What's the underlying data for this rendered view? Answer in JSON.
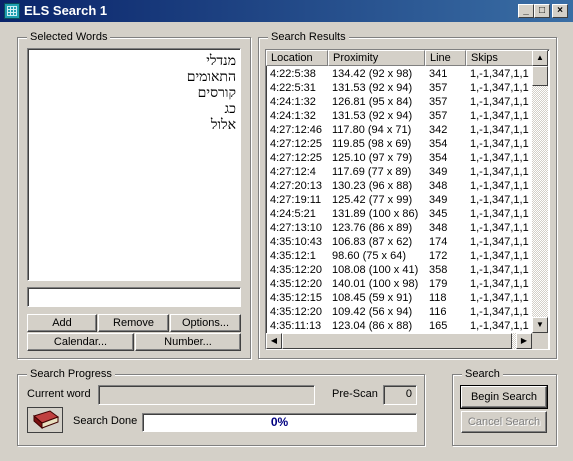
{
  "window": {
    "title": "ELS Search 1",
    "minimize": "_",
    "maximize": "□",
    "close": "×"
  },
  "selected_words": {
    "label": "Selected Words",
    "words": [
      "מנדלי",
      "התאומים",
      "קורסים",
      "כג",
      "אלול"
    ],
    "input_value": "",
    "buttons": {
      "add": "Add",
      "remove": "Remove",
      "options": "Options...",
      "calendar": "Calendar...",
      "number": "Number..."
    }
  },
  "search_results": {
    "label": "Search Results",
    "columns": [
      "Location",
      "Proximity",
      "Line",
      "Skips"
    ],
    "rows": [
      [
        "4:22:5:38",
        "134.42 (92 x 98)",
        "341",
        "1,-1,347,1,1"
      ],
      [
        "4:22:5:31",
        "131.53 (92 x 94)",
        "357",
        "1,-1,347,1,1"
      ],
      [
        "4:24:1:32",
        "126.81 (95 x 84)",
        "357",
        "1,-1,347,1,1"
      ],
      [
        "4:24:1:32",
        "131.53 (92 x 94)",
        "357",
        "1,-1,347,1,1"
      ],
      [
        "4:27:12:46",
        "117.80 (94 x 71)",
        "342",
        "1,-1,347,1,1"
      ],
      [
        "4:27:12:25",
        "119.85 (98 x 69)",
        "354",
        "1,-1,347,1,1"
      ],
      [
        "4:27:12:25",
        "125.10 (97 x 79)",
        "354",
        "1,-1,347,1,1"
      ],
      [
        "4:27:12:4",
        "117.69 (77 x 89)",
        "349",
        "1,-1,347,1,1"
      ],
      [
        "4:27:20:13",
        "130.23 (96 x 88)",
        "348",
        "1,-1,347,1,1"
      ],
      [
        "4:27:19:11",
        "125.42 (77 x 99)",
        "349",
        "1,-1,347,1,1"
      ],
      [
        "4:24:5:21",
        "131.89 (100 x 86)",
        "345",
        "1,-1,347,1,1"
      ],
      [
        "4:27:13:10",
        "123.76 (86 x 89)",
        "348",
        "1,-1,347,1,1"
      ],
      [
        "4:35:10:43",
        "106.83 (87 x 62)",
        "174",
        "1,-1,347,1,1"
      ],
      [
        "4:35:12:1",
        "98.60 (75 x 64)",
        "172",
        "1,-1,347,1,1"
      ],
      [
        "4:35:12:20",
        "108.08 (100 x 41)",
        "358",
        "1,-1,347,1,1"
      ],
      [
        "4:35:12:20",
        "140.01 (100 x 98)",
        "179",
        "1,-1,347,1,1"
      ],
      [
        "4:35:12:15",
        "108.45 (59 x 91)",
        "118",
        "1,-1,347,1,1"
      ],
      [
        "4:35:12:20",
        "109.42 (56 x 94)",
        "116",
        "1,-1,347,1,1"
      ],
      [
        "4:35:11:13",
        "123.04 (86 x 88)",
        "165",
        "1,-1,347,1,1"
      ]
    ]
  },
  "search_progress": {
    "label": "Search Progress",
    "current_word_label": "Current word",
    "current_word_value": "",
    "prescan_label": "Pre-Scan",
    "prescan_value": "0",
    "search_done_label": "Search Done",
    "progress_text": "0%",
    "progress_fraction": 0,
    "icon": "book-icon"
  },
  "search": {
    "label": "Search",
    "begin": "Begin Search",
    "cancel": "Cancel Search"
  }
}
